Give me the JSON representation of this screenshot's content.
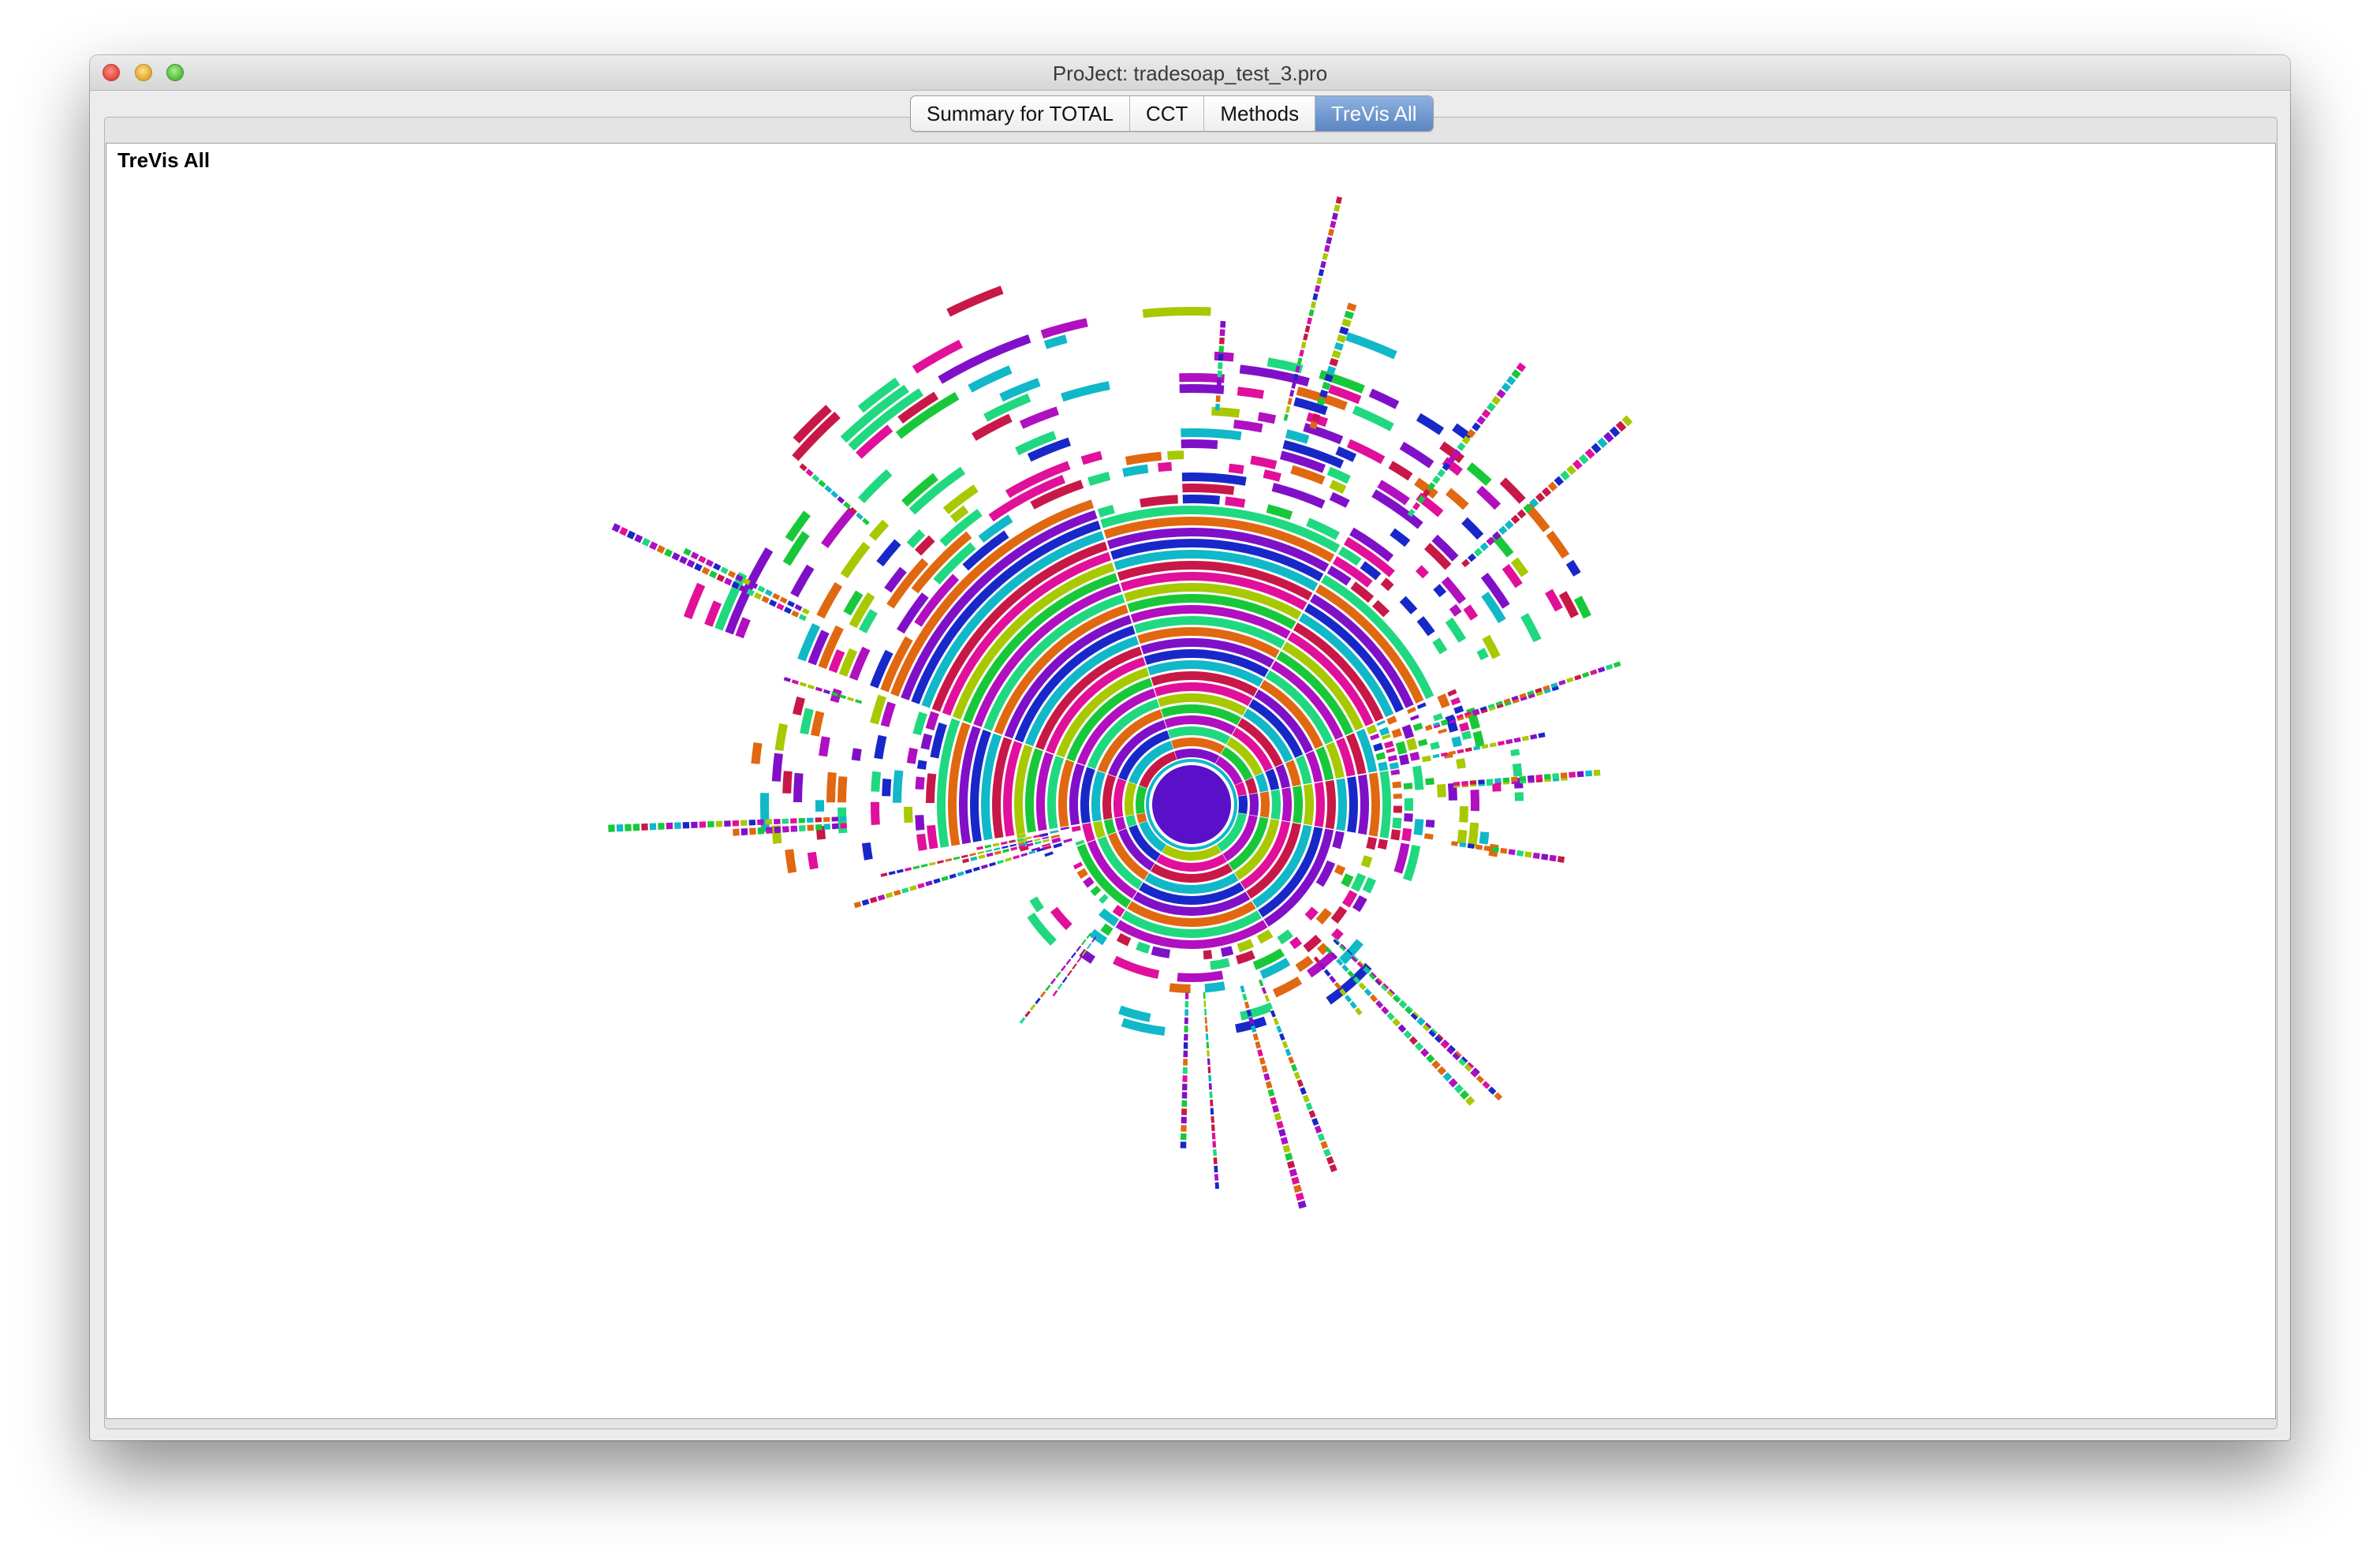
{
  "window": {
    "title": "ProJect: tradesoap_test_3.pro"
  },
  "tabs": [
    {
      "label": "Summary for TOTAL",
      "active": false
    },
    {
      "label": "CCT",
      "active": false
    },
    {
      "label": "Methods",
      "active": false
    },
    {
      "label": "TreVis All",
      "active": true
    }
  ],
  "panel": {
    "title": "TreVis All"
  },
  "visualization": {
    "type": "sunburst",
    "center_color": "#5a10c8",
    "palette": [
      "#18c83a",
      "#a8c800",
      "#e0109a",
      "#c81848",
      "#10b8c8",
      "#1828c8",
      "#8010c8",
      "#e06810",
      "#20d880",
      "#b010c0"
    ]
  }
}
